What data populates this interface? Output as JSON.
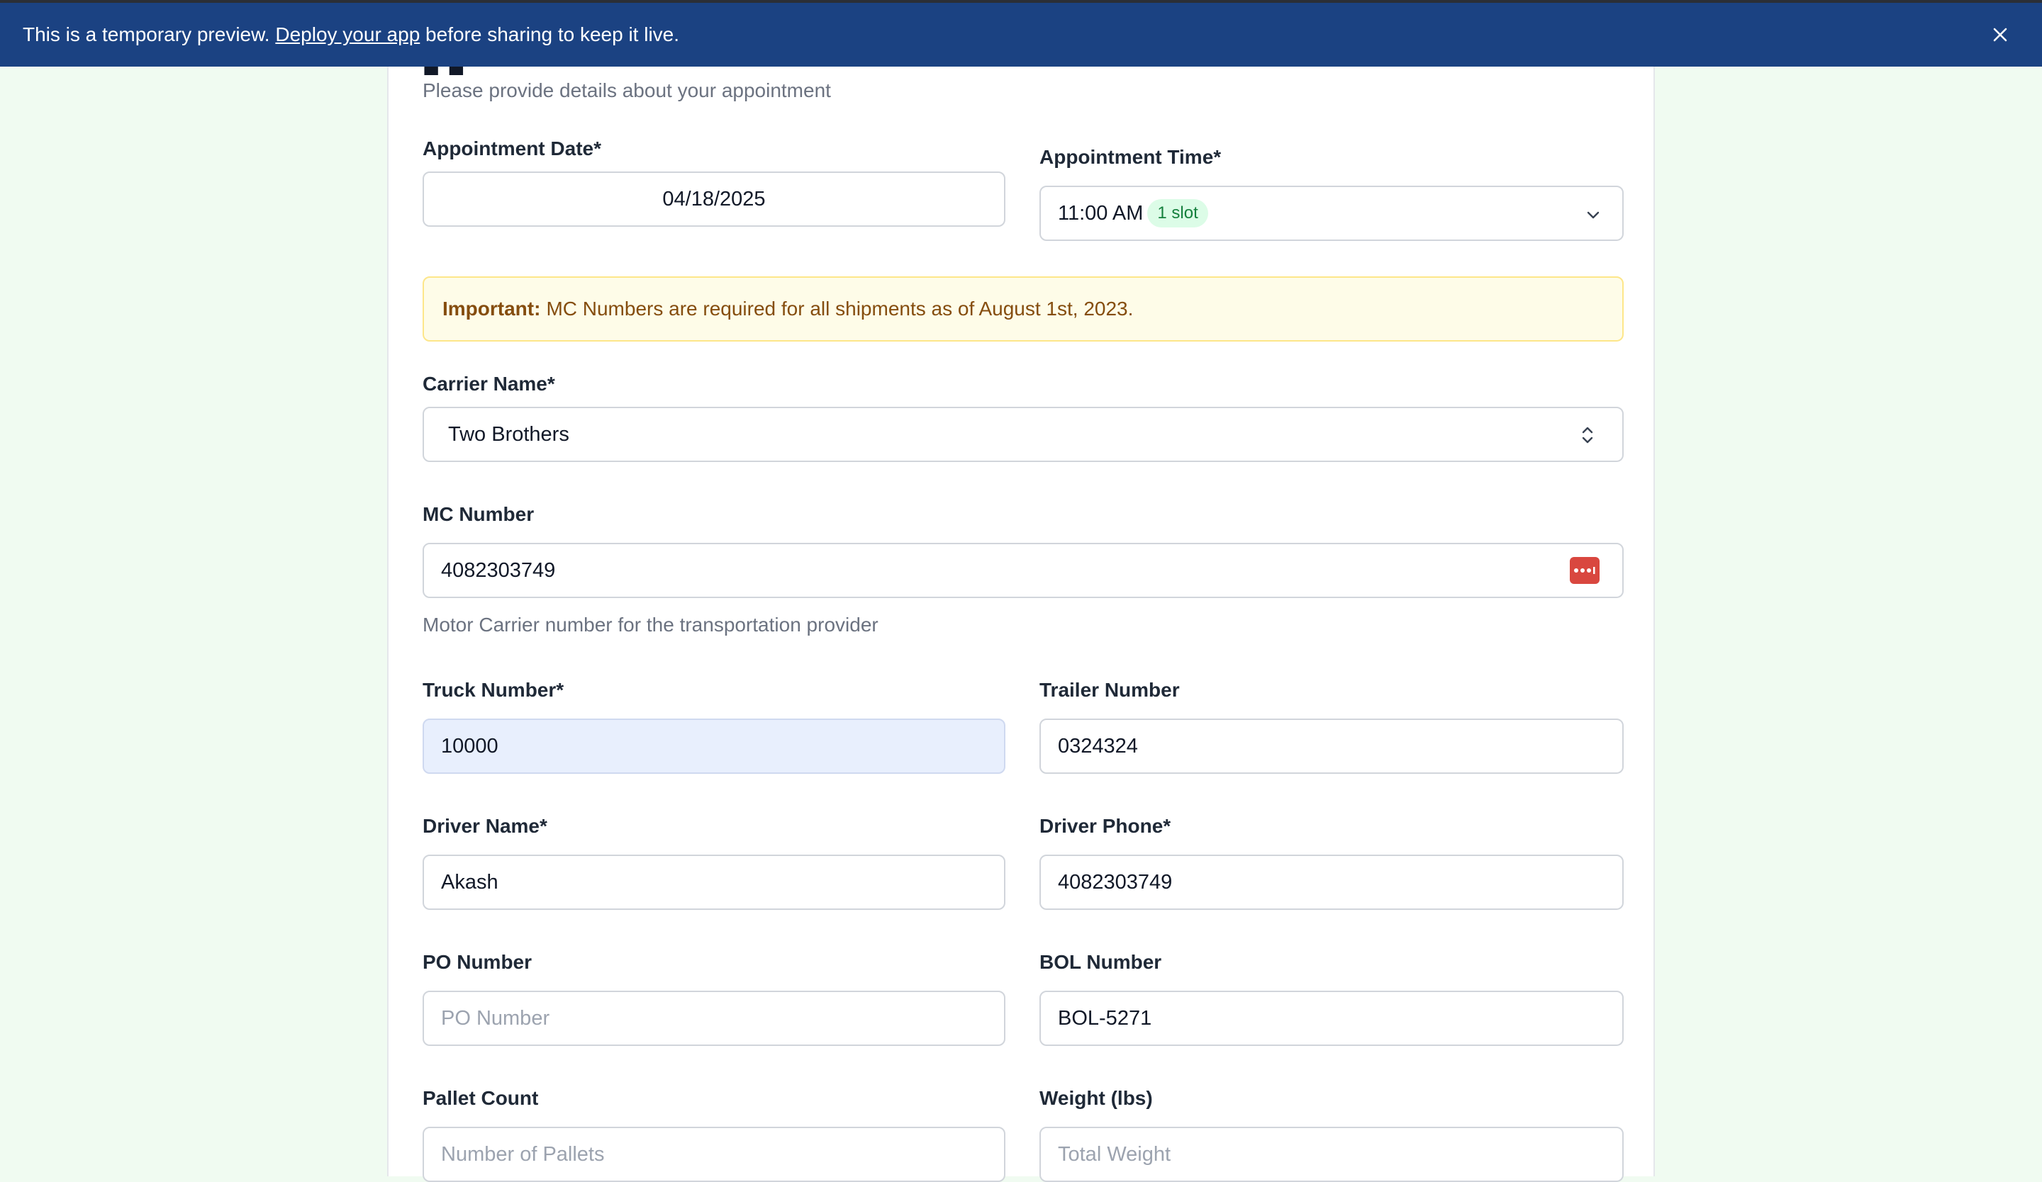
{
  "banner": {
    "prefix": "This is a temporary preview.",
    "link": "Deploy your app",
    "suffix": "before sharing to keep it live.",
    "close_icon": "close-icon"
  },
  "form": {
    "subtitle": "Please provide details about your appointment",
    "appointment_date": {
      "label": "Appointment Date*",
      "value": "04/18/2025"
    },
    "appointment_time": {
      "label": "Appointment Time*",
      "value": "11:00 AM",
      "badge": "1 slot",
      "icon": "chevron-down-icon"
    },
    "notice": {
      "bold": "Important:",
      "text": "MC Numbers are required for all shipments as of August 1st, 2023."
    },
    "carrier_name": {
      "label": "Carrier Name*",
      "value": "Two Brothers",
      "icon": "chevron-up-down-icon"
    },
    "mc_number": {
      "label": "MC Number",
      "value": "4082303749",
      "helper": "Motor Carrier number for the transportation provider",
      "icon": "password-manager-icon"
    },
    "truck_number": {
      "label": "Truck Number*",
      "value": "10000"
    },
    "trailer_number": {
      "label": "Trailer Number",
      "value": "0324324"
    },
    "driver_name": {
      "label": "Driver Name*",
      "value": "Akash"
    },
    "driver_phone": {
      "label": "Driver Phone*",
      "value": "4082303749"
    },
    "po_number": {
      "label": "PO Number",
      "placeholder": "PO Number"
    },
    "bol_number": {
      "label": "BOL Number",
      "value": "BOL-5271"
    },
    "pallet_count": {
      "label": "Pallet Count",
      "placeholder": "Number of Pallets"
    },
    "weight": {
      "label": "Weight (lbs)",
      "placeholder": "Total Weight"
    }
  },
  "colors": {
    "banner_bg": "#1b4282",
    "page_bg": "#f0fbf1",
    "notice_bg": "#fefce8",
    "notice_text": "#854d0e",
    "badge_bg": "#dcfce7",
    "badge_text": "#15803d",
    "autofill_bg": "#e8effd",
    "password_icon": "#d9473f"
  }
}
